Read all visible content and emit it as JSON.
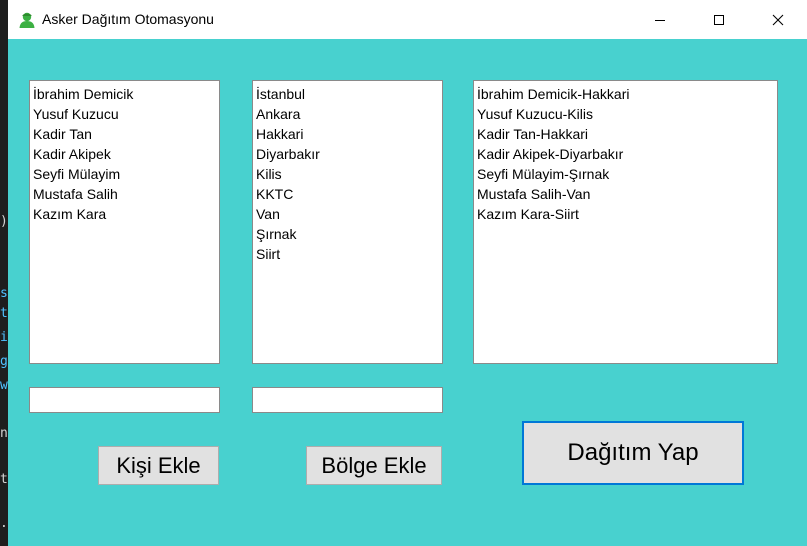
{
  "window": {
    "title": "Asker Dağıtım Otomasyonu"
  },
  "persons": {
    "items": [
      "İbrahim Demicik",
      "Yusuf Kuzucu",
      "Kadir Tan",
      "Kadir Akipek",
      "Seyfi Mülayim",
      "Mustafa Salih",
      "Kazım Kara"
    ]
  },
  "regions": {
    "items": [
      "İstanbul",
      "Ankara",
      "Hakkari",
      "Diyarbakır",
      "Kilis",
      "KKTC",
      "Van",
      "Şırnak",
      "Siirt"
    ]
  },
  "assignments": {
    "items": [
      "İbrahim Demicik-Hakkari",
      "Yusuf Kuzucu-Kilis",
      "Kadir Tan-Hakkari",
      "Kadir Akipek-Diyarbakır",
      "Seyfi Mülayim-Şırnak",
      "Mustafa Salih-Van",
      "Kazım Kara-Siirt"
    ]
  },
  "inputs": {
    "person_value": "",
    "region_value": ""
  },
  "buttons": {
    "add_person": "Kişi Ekle",
    "add_region": "Bölge Ekle",
    "distribute": "Dağıtım Yap"
  },
  "background_code": [
    ")",
    "s",
    "t",
    "i",
    "g",
    "w",
    "n",
    "t",
    "."
  ],
  "colors": {
    "form_background": "#48d1cf",
    "accent_border": "#0078d7"
  }
}
